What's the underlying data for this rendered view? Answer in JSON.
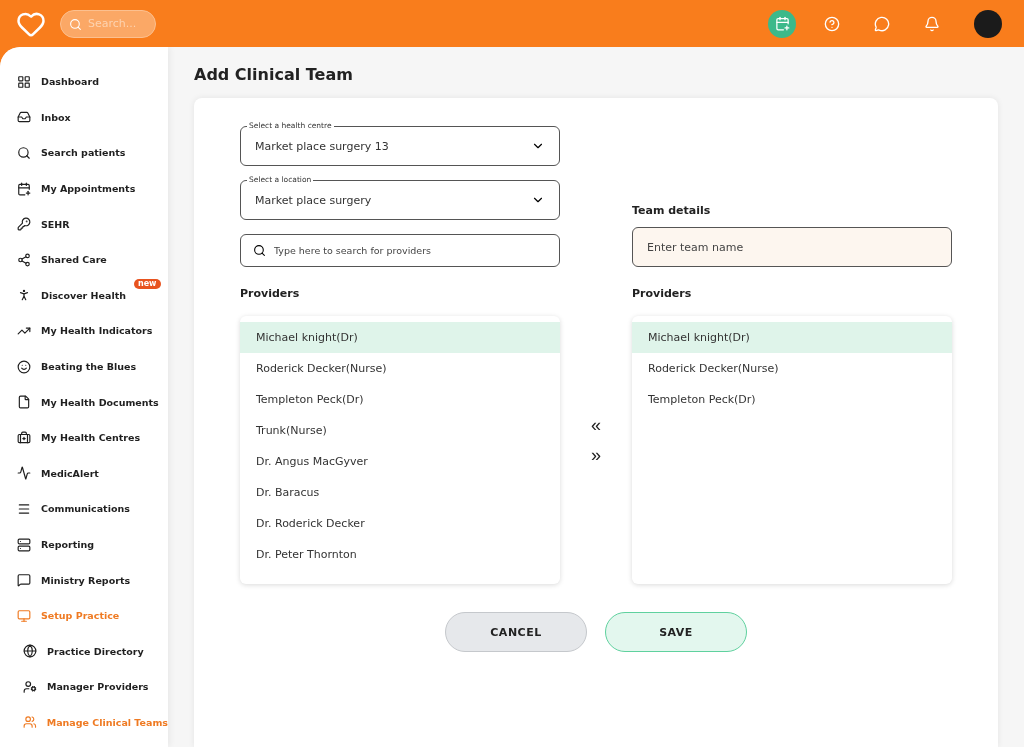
{
  "header": {
    "search": {
      "placeholder": "Search..."
    }
  },
  "sidebar": {
    "items": [
      {
        "label": "Dashboard",
        "selected": false
      },
      {
        "label": "Inbox",
        "selected": false
      },
      {
        "label": "Search patients",
        "selected": false
      },
      {
        "label": "My Appointments",
        "selected": false
      },
      {
        "label": "SEHR",
        "selected": false
      },
      {
        "label": "Shared Care",
        "selected": false
      },
      {
        "label": "Discover Health",
        "selected": false,
        "badge": "new"
      },
      {
        "label": "My Health Indicators",
        "selected": false
      },
      {
        "label": "Beating the Blues",
        "selected": false
      },
      {
        "label": "My Health Documents",
        "selected": false
      },
      {
        "label": "My Health Centres",
        "selected": false
      },
      {
        "label": "MedicAlert",
        "selected": false
      },
      {
        "label": "Communications",
        "selected": false
      },
      {
        "label": "Reporting",
        "selected": false
      },
      {
        "label": "Ministry Reports",
        "selected": false
      },
      {
        "label": "Setup Practice",
        "selected": true,
        "children": [
          {
            "label": "Practice Directory",
            "selected": false
          },
          {
            "label": "Manager Providers",
            "selected": false
          },
          {
            "label": "Manage Clinical Teams",
            "selected": true
          }
        ]
      }
    ]
  },
  "page": {
    "title": "Add Clinical Team",
    "health_centre": {
      "label": "Select a health centre",
      "value": "Market place surgery 13"
    },
    "location": {
      "label": "Select a location",
      "value": "Market place surgery"
    },
    "provider_search": {
      "placeholder": "Type here to search for providers"
    },
    "providers_heading": "Providers",
    "providers": [
      {
        "name": "Michael knight(Dr)",
        "selected": true
      },
      {
        "name": "Roderick Decker(Nurse)",
        "selected": false
      },
      {
        "name": "Templeton Peck(Dr)",
        "selected": false
      },
      {
        "name": "Trunk(Nurse)",
        "selected": false
      },
      {
        "name": "Dr. Angus MacGyver",
        "selected": false
      },
      {
        "name": "Dr. Baracus",
        "selected": false
      },
      {
        "name": "Dr. Roderick Decker",
        "selected": false
      },
      {
        "name": "Dr. Peter Thornton",
        "selected": false
      }
    ],
    "move_buttons": [
      "«",
      "»"
    ],
    "team_details_heading": "Team details",
    "team_name": {
      "placeholder": "Enter team name"
    },
    "team_providers_heading": "Providers",
    "team_providers": [
      {
        "name": "Michael knight(Dr)",
        "selected": true
      },
      {
        "name": "Roderick Decker(Nurse)",
        "selected": false
      },
      {
        "name": "Templeton Peck(Dr)",
        "selected": false
      }
    ],
    "buttons": [
      {
        "label": "CANCEL",
        "kind": "secondary"
      },
      {
        "label": "SAVE",
        "kind": "primary"
      }
    ]
  }
}
